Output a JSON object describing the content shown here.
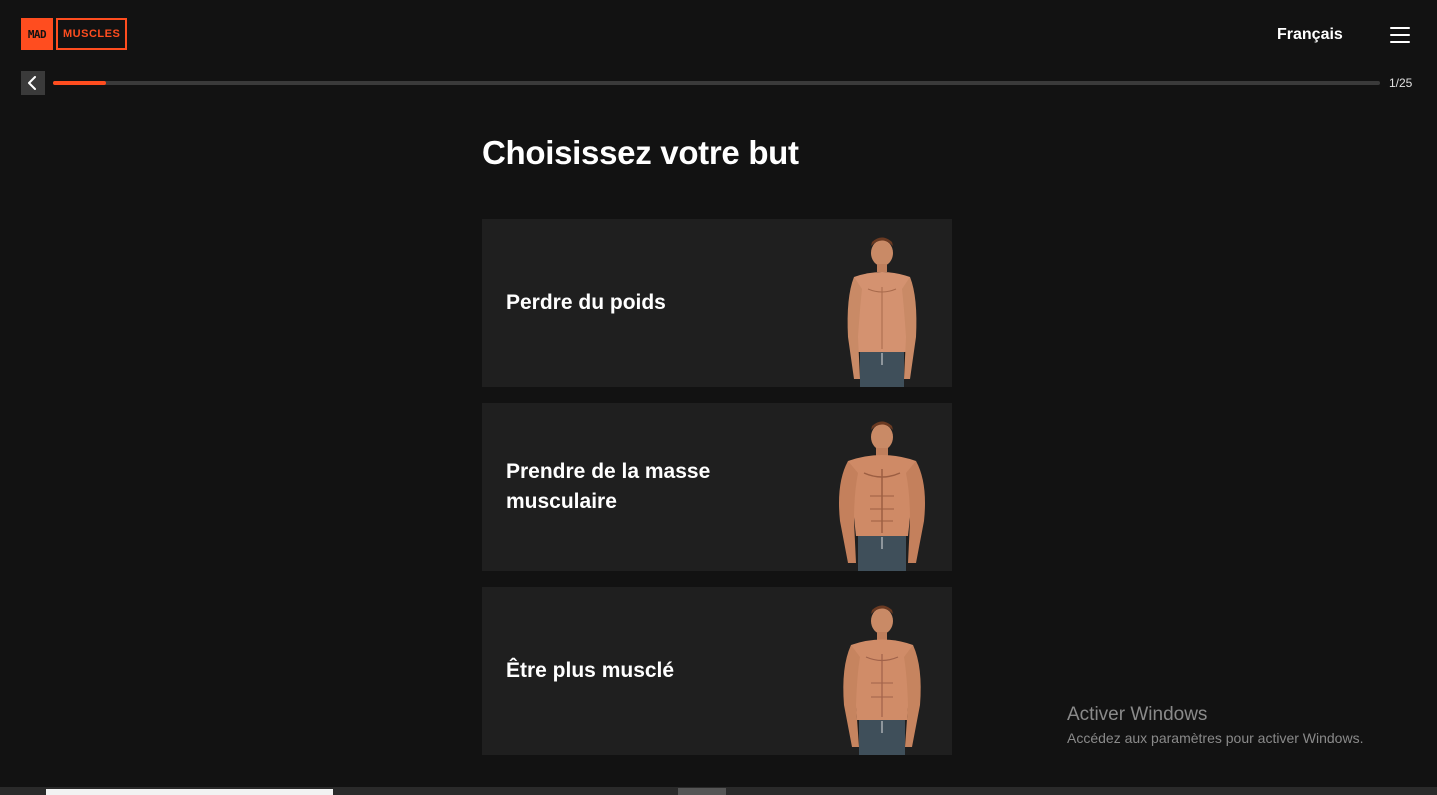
{
  "header": {
    "logo_left": "MAD",
    "logo_right": "MUSCLES",
    "language": "Français",
    "accent_color": "#ff4d1f"
  },
  "progress": {
    "step_text": "1/25",
    "fraction": 0.04
  },
  "main": {
    "title": "Choisissez votre but",
    "options": [
      {
        "label": "Perdre du poids"
      },
      {
        "label": "Prendre de la masse musculaire"
      },
      {
        "label": "Être plus musclé"
      }
    ]
  },
  "watermark": {
    "title": "Activer Windows",
    "subtitle": "Accédez aux paramètres pour activer Windows."
  }
}
